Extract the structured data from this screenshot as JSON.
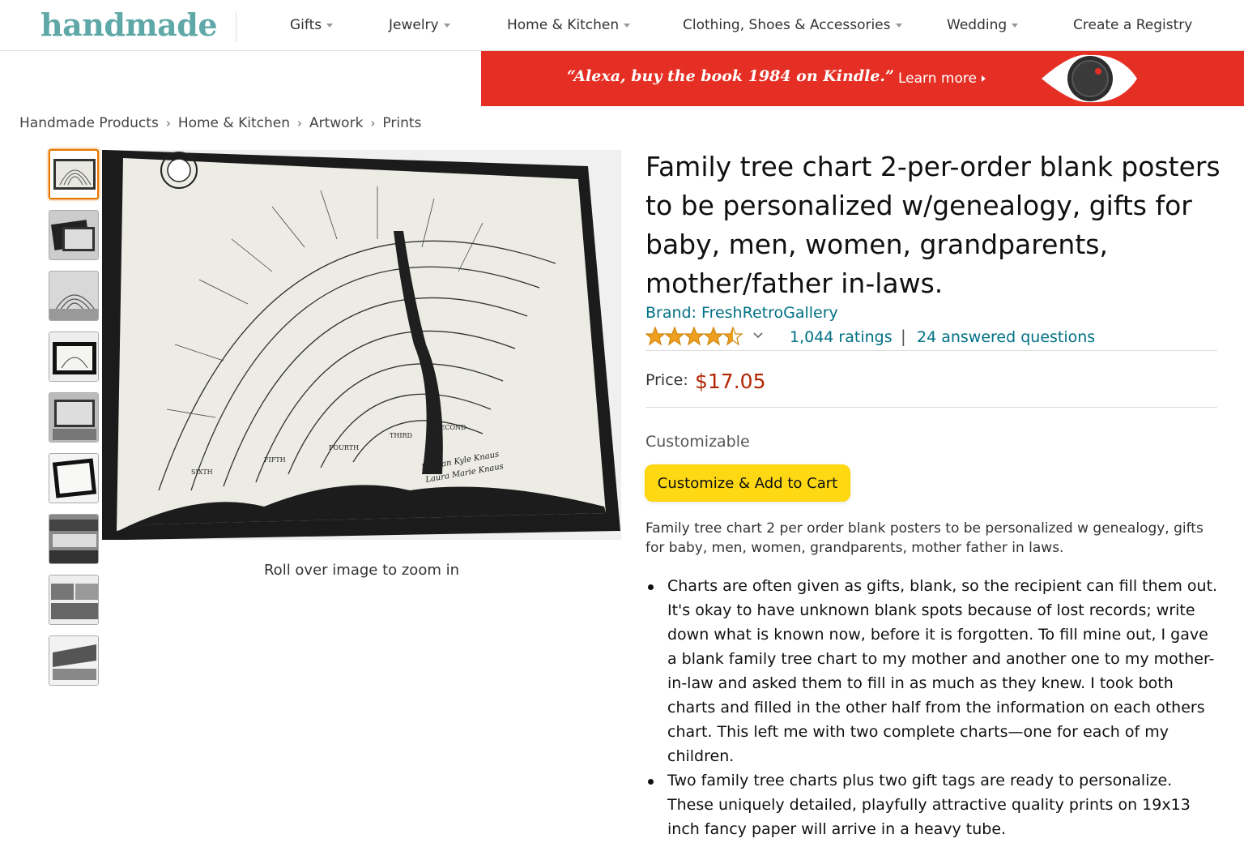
{
  "header": {
    "logo": "handmade",
    "nav": [
      {
        "label": "Gifts",
        "dropdown": true
      },
      {
        "label": "Jewelry",
        "dropdown": true
      },
      {
        "label": "Home & Kitchen",
        "dropdown": true
      },
      {
        "label": "Clothing, Shoes & Accessories",
        "dropdown": true
      },
      {
        "label": "Wedding",
        "dropdown": true
      },
      {
        "label": "Create a Registry",
        "dropdown": false
      }
    ]
  },
  "banner": {
    "quote": "“Alexa, buy the book 1984 on Kindle.”",
    "learn_more": "Learn more",
    "background": "#e52f24"
  },
  "breadcrumb": [
    "Handmade Products",
    "Home & Kitchen",
    "Artwork",
    "Prints"
  ],
  "gallery": {
    "thumbnail_count": 9,
    "active_index": 0,
    "zoom_hint": "Roll over image to zoom in"
  },
  "product": {
    "title": "Family tree chart 2-per-order blank posters to be personalized w/genealogy, gifts for baby, men, women, grandparents, mother/father in-laws.",
    "brand": "Brand: FreshRetroGallery",
    "star_rating": 4.5,
    "ratings_count": "1,044 ratings",
    "separator": "|",
    "answered_questions": "24 answered questions",
    "price_label": "Price:",
    "price": "$17.05",
    "customizable_label": "Customizable",
    "cta_label": "Customize & Add to Cart",
    "short_description": "Family tree chart 2 per order blank posters to be personalized w genealogy, gifts for baby, men, women, grandparents, mother father in laws.",
    "bullets": [
      "Charts are often given as gifts, blank, so the recipient can fill them out. It's okay to have unknown blank spots because of lost records; write down what is known now, before it is forgotten. To fill mine out, I gave a blank family tree chart to my mother and another one to my mother-in-law and asked them to fill in as much as they knew. I took both charts and filled in the other half from the information on each others chart. This left me with two complete charts—one for each of my children.",
      "Two family tree charts plus two gift tags are ready to personalize. These uniquely detailed, playfully attractive quality prints on 19x13 inch fancy paper will arrive in a heavy tube."
    ]
  },
  "colors": {
    "link": "#007185",
    "price": "#b12704",
    "cta": "#ffd814",
    "star": "#f0a020",
    "logo": "#5fa8a8",
    "thumb_active": "#e77600"
  }
}
